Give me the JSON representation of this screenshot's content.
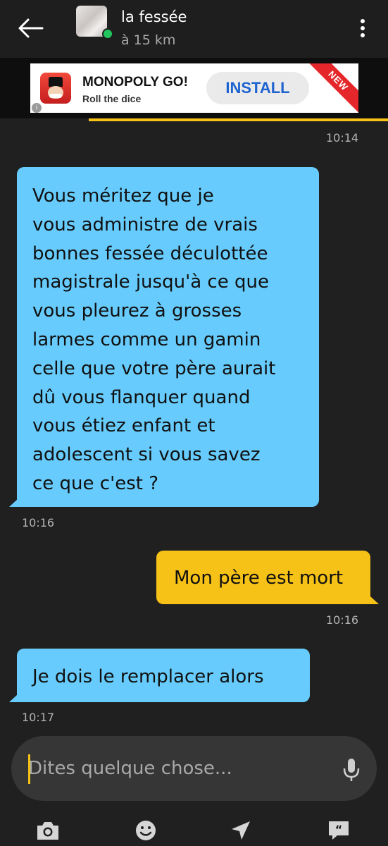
{
  "header": {
    "contact_name": "la fessée",
    "distance": "à 15 km",
    "status_color": "#22c55e"
  },
  "ad": {
    "title": "MONOPOLY GO!",
    "subtitle": "Roll the dice",
    "cta": "INSTALL",
    "ribbon": "NEW"
  },
  "messages": [
    {
      "direction": "outgoing",
      "time": "10:14"
    },
    {
      "direction": "incoming",
      "text": "Vous méritez que je\nvous administre de vrais\nbonnes fessée déculottée\nmagistrale jusqu'à ce que\nvous pleurez à grosses\nlarmes comme un gamin\ncelle que votre père aurait\ndû vous flanquer quand\nvous étiez enfant et\nadolescent si vous savez\nce que c'est ?",
      "time": "10:16"
    },
    {
      "direction": "outgoing",
      "text": "Mon père est mort",
      "time": "10:16"
    },
    {
      "direction": "incoming",
      "text": "Je dois le remplacer alors",
      "time": "10:17"
    }
  ],
  "composer": {
    "placeholder": "Dites quelque chose...",
    "value": ""
  },
  "toolbar": {
    "icons": [
      "camera-icon",
      "emoji-icon",
      "send-location-icon",
      "saved-phrases-icon"
    ]
  },
  "colors": {
    "incoming_bubble": "#67ccfd",
    "outgoing_bubble": "#f6c218",
    "background": "#202020",
    "accent": "#f6c218"
  }
}
